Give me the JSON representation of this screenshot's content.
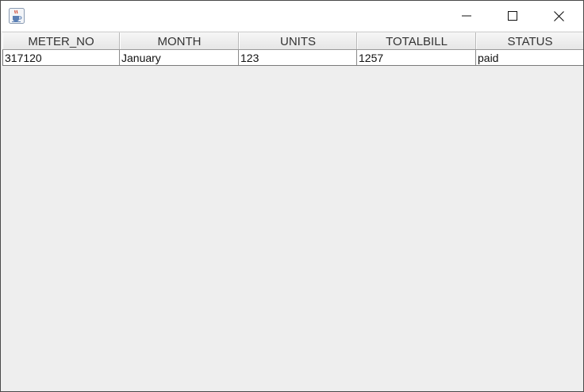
{
  "window": {
    "controls": {
      "minimize_icon": "minimize-icon",
      "maximize_icon": "maximize-icon",
      "close_icon": "close-icon"
    },
    "app_icon": "java-cup-icon"
  },
  "table": {
    "headers": [
      "METER_NO",
      "MONTH",
      "UNITS",
      "TOTALBILL",
      "STATUS"
    ],
    "rows": [
      [
        "317120",
        "January",
        "123",
        "1257",
        "paid"
      ]
    ]
  },
  "colors": {
    "titlebar": "#ffffff",
    "content_background": "#eeeeee",
    "row_background": "#ffffff"
  }
}
